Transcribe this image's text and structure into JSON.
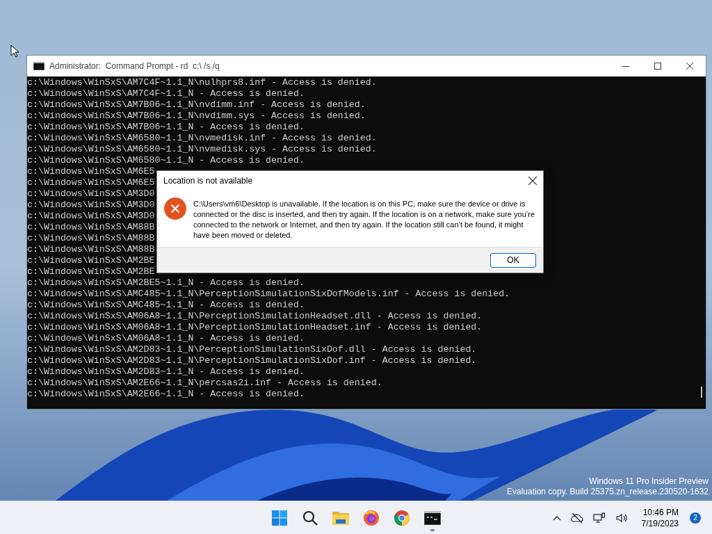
{
  "console_window": {
    "title": "Administrator:  Command Prompt - rd  c:\\ /s /q",
    "lines": [
      "c:\\Windows\\WinSxS\\AM7C4F~1.1_N\\nulhprs8.inf - Access is denied.",
      "c:\\Windows\\WinSxS\\AM7C4F~1.1_N - Access is denied.",
      "c:\\Windows\\WinSxS\\AM7B06~1.1_N\\nvdimm.inf - Access is denied.",
      "c:\\Windows\\WinSxS\\AM7B06~1.1_N\\nvdimm.sys - Access is denied.",
      "c:\\Windows\\WinSxS\\AM7B06~1.1_N - Access is denied.",
      "c:\\Windows\\WinSxS\\AM6580~1.1_N\\nvmedisk.inf - Access is denied.",
      "c:\\Windows\\WinSxS\\AM6580~1.1_N\\nvmedisk.sys - Access is denied.",
      "c:\\Windows\\WinSxS\\AM6580~1.1_N - Access is denied.",
      "c:\\Windows\\WinSxS\\AM6E5",
      "c:\\Windows\\WinSxS\\AM6E5",
      "c:\\Windows\\WinSxS\\AM3D0",
      "c:\\Windows\\WinSxS\\AM3D0",
      "c:\\Windows\\WinSxS\\AM3D0",
      "c:\\Windows\\WinSxS\\AM88B",
      "c:\\Windows\\WinSxS\\AM88B",
      "c:\\Windows\\WinSxS\\AM88B",
      "c:\\Windows\\WinSxS\\AM2BE",
      "c:\\Windows\\WinSxS\\AM2BE",
      "c:\\Windows\\WinSxS\\AM2BE5~1.1_N - Access is denied.",
      "c:\\Windows\\WinSxS\\AMC485~1.1_N\\PerceptionSimulationSixDofModels.inf - Access is denied.",
      "c:\\Windows\\WinSxS\\AMC485~1.1_N - Access is denied.",
      "c:\\Windows\\WinSxS\\AM06A8~1.1_N\\PerceptionSimulationHeadset.dll - Access is denied.",
      "c:\\Windows\\WinSxS\\AM06A8~1.1_N\\PerceptionSimulationHeadset.inf - Access is denied.",
      "c:\\Windows\\WinSxS\\AM06A8~1.1_N - Access is denied.",
      "c:\\Windows\\WinSxS\\AM2D83~1.1_N\\PerceptionSimulationSixDof.dll - Access is denied.",
      "c:\\Windows\\WinSxS\\AM2D83~1.1_N\\PerceptionSimulationSixDof.inf - Access is denied.",
      "c:\\Windows\\WinSxS\\AM2D83~1.1_N - Access is denied.",
      "c:\\Windows\\WinSxS\\AM2E66~1.1_N\\percsas2i.inf - Access is denied.",
      "c:\\Windows\\WinSxS\\AM2E66~1.1_N - Access is denied."
    ]
  },
  "dialog": {
    "title": "Location is not available",
    "message": "C:\\Users\\vm6\\Desktop is unavailable. If the location is on this PC, make sure the device or drive is connected or the disc is inserted, and then try again. If the location is on a network, make sure you’re connected to the network or Internet, and then try again. If the location still can’t be found, it might have been moved or deleted.",
    "button": "OK"
  },
  "watermark": [
    "Windows 11 Pro Insider Preview",
    "Evaluation copy. Build 25375.zn_release.230520-1632"
  ],
  "taskbar": {
    "apps": [
      {
        "kind": "start",
        "running": false
      },
      {
        "kind": "search",
        "running": false
      },
      {
        "kind": "folder",
        "running": false
      },
      {
        "kind": "firefox",
        "running": false
      },
      {
        "kind": "chrome",
        "running": false
      },
      {
        "kind": "terminal",
        "running": true
      }
    ],
    "time": "10:46 PM",
    "date": "7/19/2023",
    "notifications": "2"
  }
}
